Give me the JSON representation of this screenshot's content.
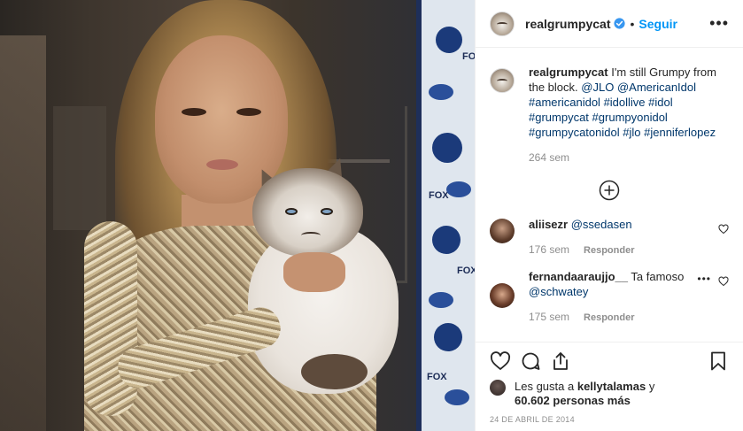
{
  "post": {
    "username": "realgrumpycat",
    "follow_label": "Seguir",
    "more_label": "•••"
  },
  "caption": {
    "username": "realgrumpycat",
    "text": "I'm still Grumpy from the block.",
    "mentions": [
      "@JLO",
      "@AmericanIdol"
    ],
    "hashtags": [
      "#americanidol",
      "#idollive",
      "#idol",
      "#grumpycat",
      "#grumpyonidol",
      "#grumpycatonidol",
      "#jlo",
      "#jenniferlopez"
    ],
    "time": "264 sem"
  },
  "comments": [
    {
      "username": "aliisezr",
      "text": "@ssedasen",
      "time": "176 sem",
      "reply_label": "Responder"
    },
    {
      "username": "fernandaaraujjo__",
      "text": "Ta famoso",
      "mention": "@schwatey",
      "time": "175 sem",
      "reply_label": "Responder"
    }
  ],
  "likes": {
    "prefix": "Les gusta a",
    "user": "kellytalamas",
    "conjunction": "y",
    "count": "60.602 personas más"
  },
  "date": "24 DE ABRIL DE 2014",
  "backdrop": {
    "brand_fox": "FOX"
  },
  "colors": {
    "link": "#00376b",
    "follow": "#0095f6",
    "verified": "#3897f0",
    "muted": "#8e8e8e"
  },
  "icons": [
    "verified-badge-icon",
    "add-comment-icon",
    "heart-icon",
    "comment-icon",
    "share-icon",
    "bookmark-icon",
    "more-options-icon"
  ]
}
